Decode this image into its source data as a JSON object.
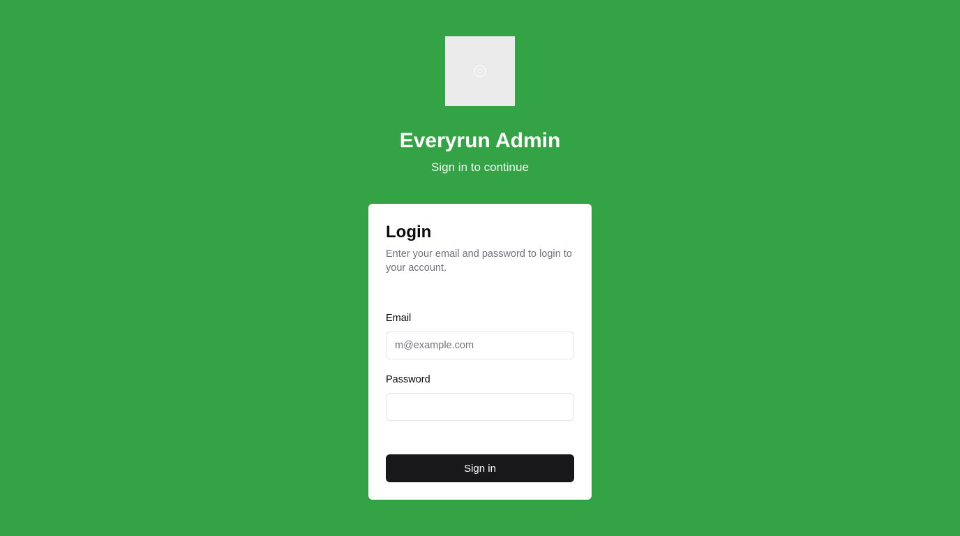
{
  "app": {
    "title": "Everyrun Admin",
    "subtitle": "Sign in to continue",
    "logo_icon": "image-placeholder-icon"
  },
  "login_card": {
    "title": "Login",
    "description": "Enter your email and password to login to your account.",
    "email": {
      "label": "Email",
      "placeholder": "m@example.com",
      "value": ""
    },
    "password": {
      "label": "Password",
      "placeholder": "",
      "value": ""
    },
    "submit_label": "Sign in"
  },
  "colors": {
    "background": "#33a345",
    "card": "#ffffff",
    "button": "#18181b",
    "muted_text": "#71717a"
  }
}
